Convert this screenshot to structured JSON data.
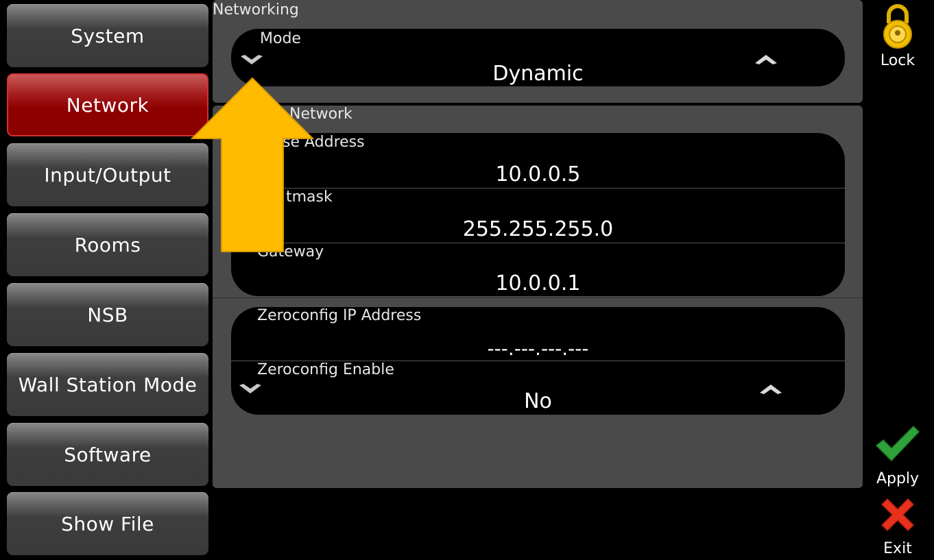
{
  "sidebar": {
    "items": [
      {
        "label": "System"
      },
      {
        "label": "Network"
      },
      {
        "label": "Input/Output"
      },
      {
        "label": "Rooms"
      },
      {
        "label": "NSB"
      },
      {
        "label": "Wall Station Mode"
      },
      {
        "label": "Software"
      },
      {
        "label": "Show File"
      }
    ],
    "active": "Network"
  },
  "networking": {
    "title": "Networking",
    "mode_label": "Mode",
    "mode_value": "Dynamic"
  },
  "network": {
    "title": "Network",
    "address_label": "se Address",
    "address_value": "10.0.0.5",
    "netmask_label": "tmask",
    "netmask_value": "255.255.255.0",
    "gateway_label": "Gateway",
    "gateway_value": "10.0.0.1"
  },
  "zeroconfig": {
    "ip_label": "Zeroconfig IP Address",
    "ip_value": "---.---.---.---",
    "enable_label": "Zeroconfig Enable",
    "enable_value": "No"
  },
  "actions": {
    "lock_label": "Lock",
    "apply_label": "Apply",
    "exit_label": "Exit"
  },
  "colors": {
    "active_tab": "#8f0000",
    "arrow": "#ffbb00",
    "apply": "#2fa33a",
    "exit": "#e8311c",
    "lock": "#f0c000"
  },
  "icons": [
    "lock-icon",
    "checkmark-icon",
    "close-icon",
    "chevron-down-icon",
    "chevron-up-icon",
    "arrow-up-icon"
  ]
}
